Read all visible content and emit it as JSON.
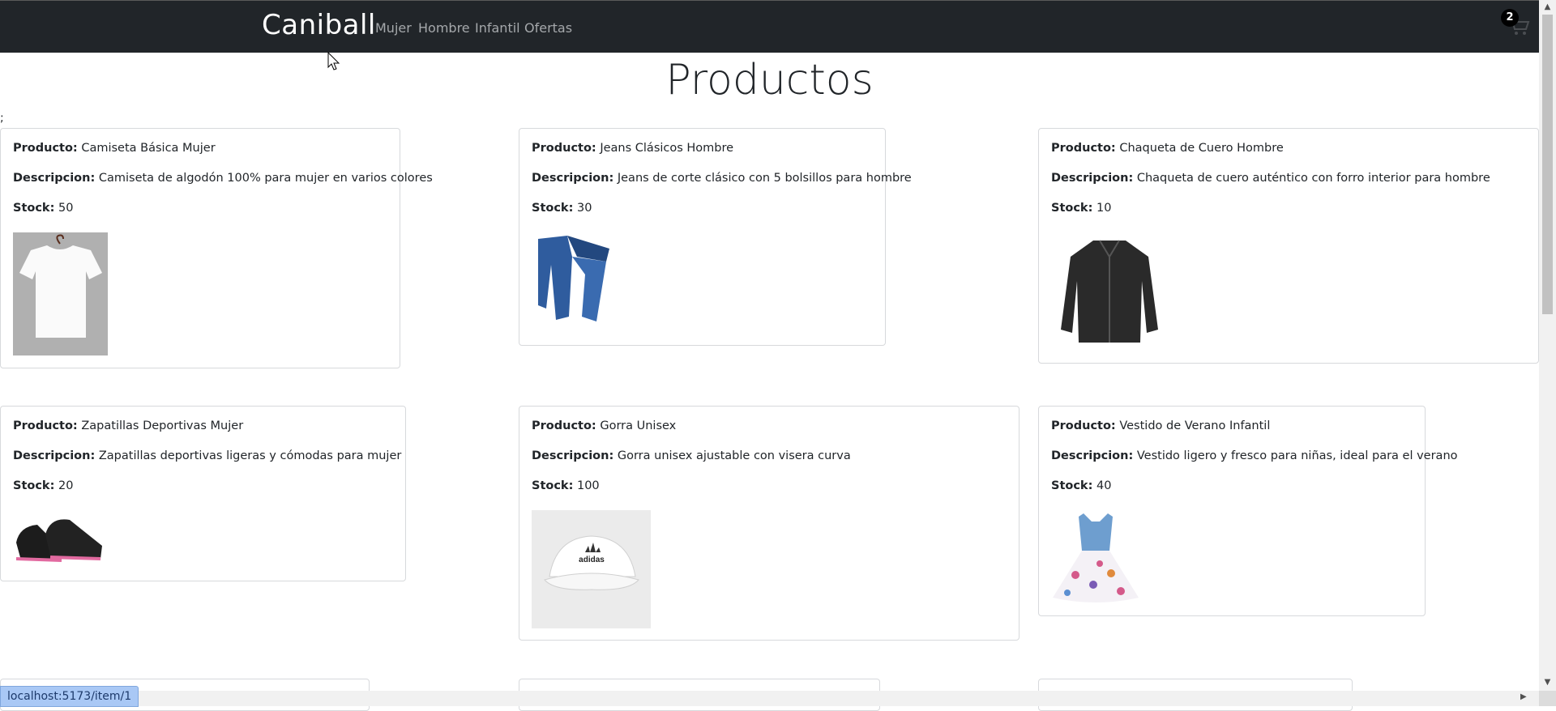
{
  "navbar": {
    "brand": "Caniball",
    "links": [
      "Mujer",
      "Hombre",
      "Infantil",
      "Ofertas"
    ],
    "cart_count": "2"
  },
  "page": {
    "title": "Productos",
    "stray_text": ";"
  },
  "labels": {
    "product": "Producto:",
    "description": "Descripcion:",
    "stock": "Stock:"
  },
  "products": [
    {
      "name": "Camiseta Básica Mujer",
      "description": "Camiseta de algodón 100% para mujer en varios colores",
      "stock": "50",
      "image_icon": "white-tshirt-image"
    },
    {
      "name": "Jeans Clásicos Hombre",
      "description": "Jeans de corte clásico con 5 bolsillos para hombre",
      "stock": "30",
      "image_icon": "blue-jeans-image"
    },
    {
      "name": "Chaqueta de Cuero Hombre",
      "description": "Chaqueta de cuero auténtico con forro interior para hombre",
      "stock": "10",
      "image_icon": "leather-jacket-image"
    },
    {
      "name": "Zapatillas Deportivas Mujer",
      "description": "Zapatillas deportivas ligeras y cómodas para mujer",
      "stock": "20",
      "image_icon": "sneakers-image"
    },
    {
      "name": "Gorra Unisex",
      "description": "Gorra unisex ajustable con visera curva",
      "stock": "100",
      "image_icon": "cap-image",
      "image_text": "adidas"
    },
    {
      "name": "Vestido de Verano Infantil",
      "description": "Vestido ligero y fresco para niñas, ideal para el verano",
      "stock": "40",
      "image_icon": "summer-dress-image"
    }
  ],
  "status_bar": {
    "url": "localhost:5173/item/1"
  },
  "colors": {
    "navbar_bg": "#212529",
    "nav_link": "#a5a8ab",
    "card_border": "#d7d9dc"
  }
}
